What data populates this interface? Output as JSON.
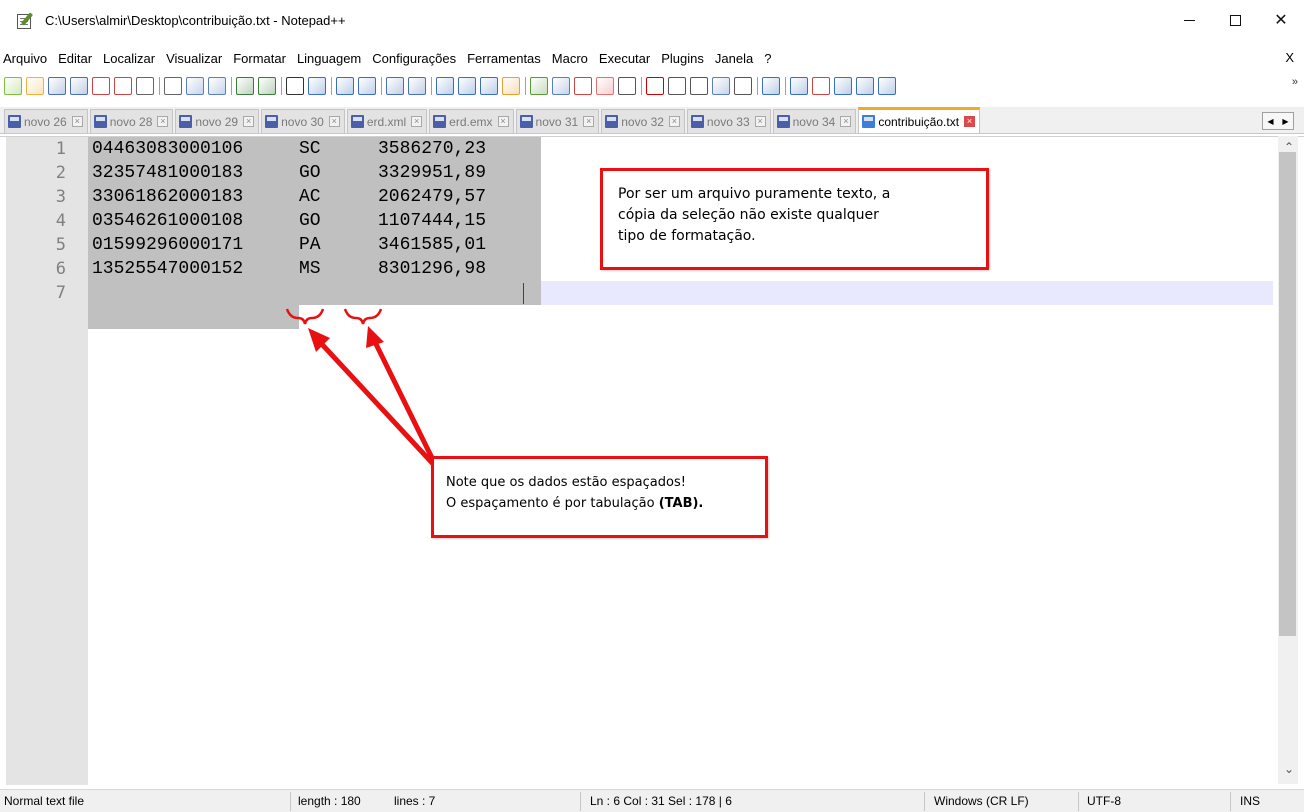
{
  "window": {
    "title": "C:\\Users\\almir\\Desktop\\contribuição.txt - Notepad++",
    "controls": {
      "minimize": "—",
      "maximize": "☐",
      "close": "✕"
    }
  },
  "menu": {
    "items": [
      "Arquivo",
      "Editar",
      "Localizar",
      "Visualizar",
      "Formatar",
      "Linguagem",
      "Configurações",
      "Ferramentas",
      "Macro",
      "Executar",
      "Plugins",
      "Janela",
      "?"
    ],
    "close_label": "X"
  },
  "toolbar": {
    "buttons": [
      "new-file-icon",
      "open-file-icon",
      "save-icon",
      "save-all-icon",
      "close-icon",
      "close-all-icon",
      "print-icon",
      "cut-icon",
      "copy-icon",
      "paste-icon",
      "undo-icon",
      "redo-icon",
      "find-icon",
      "replace-icon",
      "zoom-in-icon",
      "zoom-out-icon",
      "sync-vertical-icon",
      "sync-horizontal-icon",
      "word-wrap-icon",
      "show-all-chars-icon",
      "indent-guide-icon",
      "udl-icon",
      "doc-map-icon",
      "doc-list-icon",
      "function-list-icon",
      "folder-workspace-icon",
      "monitoring-icon",
      "record-macro-icon",
      "stop-macro-icon",
      "play-macro-icon",
      "run-macro-multiple-icon",
      "save-macro-icon",
      "compare-icon",
      "compare-diff-icon",
      "compare-clear-icon",
      "first-diff-icon",
      "prev-diff-icon",
      "next-diff-icon"
    ],
    "more_label": "»"
  },
  "tabs": [
    {
      "label": "novo 26",
      "active": false
    },
    {
      "label": "novo 28",
      "active": false
    },
    {
      "label": "novo 29",
      "active": false
    },
    {
      "label": "novo 30",
      "active": false
    },
    {
      "label": "erd.xml",
      "active": false
    },
    {
      "label": "erd.emx",
      "active": false
    },
    {
      "label": "novo 31",
      "active": false
    },
    {
      "label": "novo 32",
      "active": false
    },
    {
      "label": "novo 33",
      "active": false
    },
    {
      "label": "novo 34",
      "active": false
    },
    {
      "label": "contribuição.txt",
      "active": true
    }
  ],
  "editor": {
    "line_numbers": [
      "1",
      "2",
      "3",
      "4",
      "5",
      "6",
      "7"
    ],
    "lines": [
      {
        "code": "04463083000106",
        "state": "SC",
        "value": "3586270,23"
      },
      {
        "code": "32357481000183",
        "state": "GO",
        "value": "3329951,89"
      },
      {
        "code": "33061862000183",
        "state": "AC",
        "value": "2062479,57"
      },
      {
        "code": "03546261000108",
        "state": "GO",
        "value": "1107444,15"
      },
      {
        "code": "01599296000171",
        "state": "PA",
        "value": "3461585,01"
      },
      {
        "code": "13525547000152",
        "state": "MS",
        "value": "8301296,98"
      },
      {
        "code": "",
        "state": "",
        "value": ""
      }
    ]
  },
  "annotations": {
    "callout_top": {
      "line1": "Por ser um arquivo puramente texto, a",
      "line2": "cópia da seleção não existe qualquer",
      "line3": "tipo de formatação."
    },
    "callout_bottom": {
      "line1": "Note que os dados estão espaçados!",
      "line2_prefix": "O espaçamento é por tabulação ",
      "line2_bold": "(TAB)."
    },
    "highlight_color": "#e81010"
  },
  "statusbar": {
    "file_type": "Normal text file",
    "length": "length : 180",
    "lines": "lines : 7",
    "position": "Ln : 6    Col : 31    Sel : 178 | 6",
    "eol": "Windows (CR LF)",
    "encoding": "UTF-8",
    "mode": "INS"
  }
}
